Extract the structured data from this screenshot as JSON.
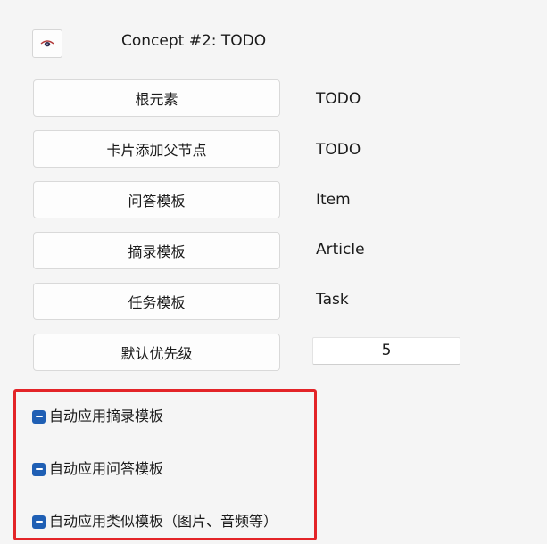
{
  "header": {
    "title": "Concept #2: TODO",
    "toggle_icon": "eye-icon"
  },
  "rows": [
    {
      "button_label": "根元素",
      "value": "TODO"
    },
    {
      "button_label": "卡片添加父节点",
      "value": "TODO"
    },
    {
      "button_label": "问答模板",
      "value": "Item"
    },
    {
      "button_label": "摘录模板",
      "value": "Article"
    },
    {
      "button_label": "任务模板",
      "value": "Task"
    }
  ],
  "priority": {
    "button_label": "默认优先级",
    "value": "5"
  },
  "checkboxes": [
    {
      "label": "自动应用摘录模板",
      "state": "indeterminate"
    },
    {
      "label": "自动应用问答模板",
      "state": "indeterminate"
    },
    {
      "label": "自动应用类似模板（图片、音频等）",
      "state": "indeterminate"
    }
  ],
  "colors": {
    "checkbox": "#1f5fb4",
    "highlight_border": "#e32428",
    "background": "#f5f5f5"
  }
}
